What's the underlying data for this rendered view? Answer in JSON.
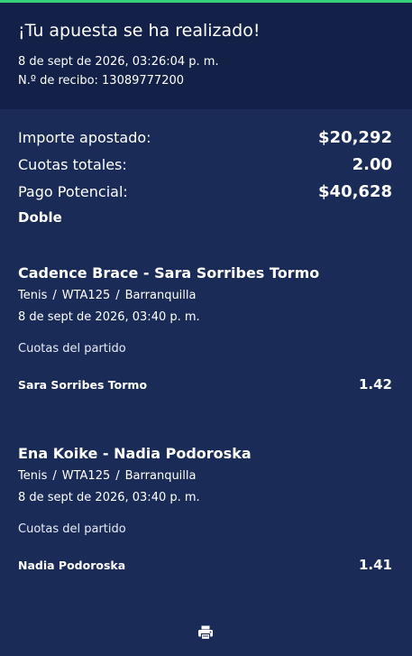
{
  "receipt": {
    "title": "¡Tu apuesta se ha realizado!",
    "datetime": "8 de sept de 2026, 03:26:04 p. m.",
    "receipt_number": "N.º de recibo: 13089777200"
  },
  "summary": {
    "stake_label": "Importe apostado:",
    "stake_value": "$20,292",
    "total_odds_label": "Cuotas totales:",
    "total_odds_value": "2.00",
    "payout_label": "Pago Potencial:",
    "payout_value": "$40,628",
    "bet_type": "Doble"
  },
  "selections": [
    {
      "match": "Cadence Brace - Sara Sorribes Tormo",
      "sport": "Tenis",
      "competition": "WTA125",
      "venue": "Barranquilla",
      "date": "8 de sept de 2026, 03:40 p. m.",
      "odds_label": "Cuotas del partido",
      "selection": "Sara Sorribes Tormo",
      "odds": "1.42"
    },
    {
      "match": "Ena Koike - Nadia Podoroska",
      "sport": "Tenis",
      "competition": "WTA125",
      "venue": "Barranquilla",
      "date": "8 de sept de 2026, 03:40 p. m.",
      "odds_label": "Cuotas del partido",
      "selection": "Nadia Podoroska",
      "odds": "1.41"
    }
  ],
  "separator": "/",
  "icons": {
    "print": "print-icon"
  },
  "colors": {
    "background": "#1a2b57",
    "header_background": "#132148",
    "accent": "#36d27a",
    "text": "#ffffff"
  }
}
